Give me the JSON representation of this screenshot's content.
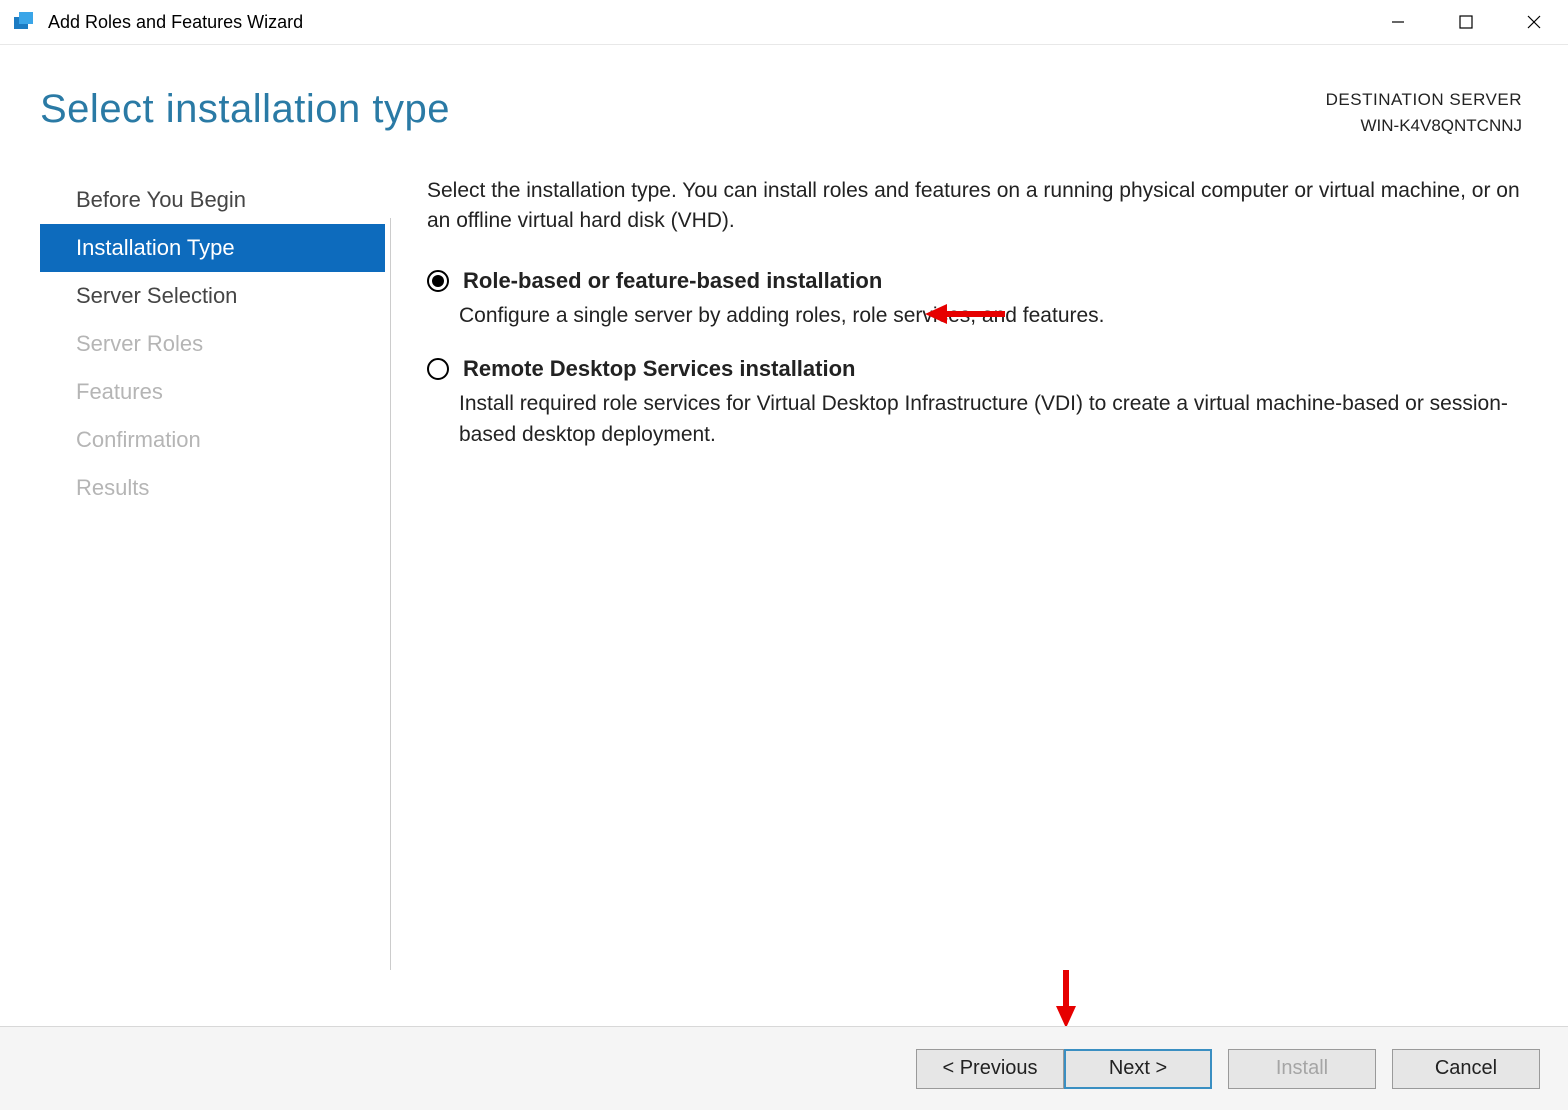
{
  "window": {
    "title": "Add Roles and Features Wizard"
  },
  "header": {
    "page_title": "Select installation type",
    "dest_label": "DESTINATION SERVER",
    "dest_server": "WIN-K4V8QNTCNNJ"
  },
  "sidebar": {
    "items": [
      {
        "label": "Before You Begin",
        "state": "normal"
      },
      {
        "label": "Installation Type",
        "state": "active"
      },
      {
        "label": "Server Selection",
        "state": "normal"
      },
      {
        "label": "Server Roles",
        "state": "disabled"
      },
      {
        "label": "Features",
        "state": "disabled"
      },
      {
        "label": "Confirmation",
        "state": "disabled"
      },
      {
        "label": "Results",
        "state": "disabled"
      }
    ]
  },
  "content": {
    "intro": "Select the installation type. You can install roles and features on a running physical computer or virtual machine, or on an offline virtual hard disk (VHD).",
    "options": [
      {
        "title": "Role-based or feature-based installation",
        "desc": "Configure a single server by adding roles, role services, and features.",
        "selected": true
      },
      {
        "title": "Remote Desktop Services installation",
        "desc": "Install required role services for Virtual Desktop Infrastructure (VDI) to create a virtual machine-based or session-based desktop deployment.",
        "selected": false
      }
    ]
  },
  "footer": {
    "previous": "< Previous",
    "next": "Next >",
    "install": "Install",
    "cancel": "Cancel"
  },
  "colors": {
    "accent": "#0d6bbd",
    "title_blue": "#2a7aa5",
    "arrow_red": "#e60000"
  }
}
